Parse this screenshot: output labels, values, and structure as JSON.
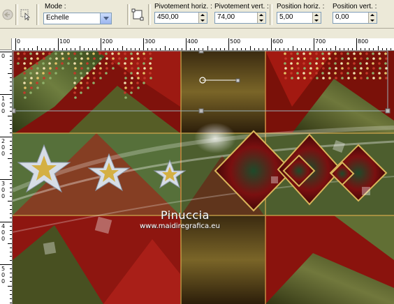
{
  "toolbar": {
    "mode_label": "Mode :",
    "mode_value": "Echelle",
    "pivot_h_label": "Pivotement horiz. :",
    "pivot_h_value": "450,00",
    "pivot_v_label": "Pivotement vert. :",
    "pivot_v_value": "74,00",
    "pos_h_label": "Position horiz. :",
    "pos_h_value": "5,00",
    "pos_v_label": "Position vert. :",
    "pos_v_value": "0,00",
    "icons": [
      "undo-icon",
      "pick-tool-icon",
      "transform-icon"
    ]
  },
  "ruler": {
    "h_labels": [
      "0",
      "100",
      "200",
      "300",
      "400",
      "500",
      "600",
      "700",
      "800"
    ],
    "v_labels": [
      "0",
      "100",
      "200",
      "300",
      "400",
      "500"
    ]
  },
  "watermark": {
    "name": "Pinuccia",
    "url": "www.maidiregrafica.eu"
  },
  "colors": {
    "accent": "#7f9db9",
    "toolbar_bg": "#ece9d8",
    "canvas_red": "#8b1410",
    "canvas_green": "#4a6a2c",
    "gold": "#c9a24a"
  }
}
